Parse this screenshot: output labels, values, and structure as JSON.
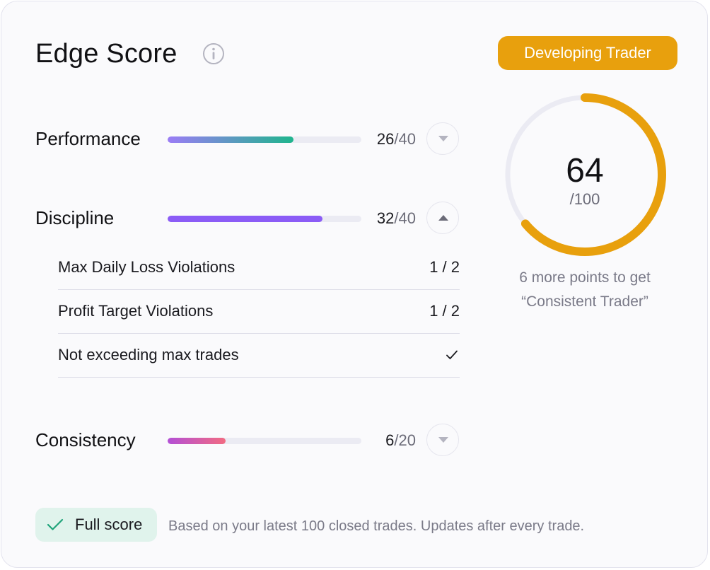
{
  "card": {
    "title": "Edge Score",
    "badge": "Developing Trader"
  },
  "categories": [
    {
      "label": "Performance",
      "score": "26",
      "max": "/40",
      "progress": 0.65,
      "gradient": [
        "#9b7cf6",
        "#1fb58d"
      ],
      "expanded": false
    },
    {
      "label": "Discipline",
      "score": "32",
      "max": "/40",
      "progress": 0.8,
      "gradient": [
        "#8b5cf6",
        "#8b5cf6"
      ],
      "expanded": true,
      "details": [
        {
          "label": "Max Daily Loss Violations",
          "value": "1 / 2"
        },
        {
          "label": "Profit Target Violations",
          "value": "1 / 2"
        },
        {
          "label": "Not exceeding max trades",
          "value": "",
          "icon": "check-icon"
        }
      ]
    },
    {
      "label": "Consistency",
      "score": "6",
      "max": "/20",
      "progress": 0.3,
      "gradient": [
        "#b34fd6",
        "#f26b82"
      ],
      "expanded": false
    }
  ],
  "total": {
    "value": "64",
    "max": "/100",
    "progress": 0.64,
    "color": "#e8a00d",
    "track_color": "#ebebf3",
    "next_line1": "6 more points to get",
    "next_line2": "“Consistent Trader”"
  },
  "footer": {
    "pill_label": "Full score",
    "note": "Based on your latest 100 closed trades. Updates after every trade."
  },
  "colors": {
    "accent": "#e8a00d",
    "success": "#1fa47a",
    "pill_bg": "#e0f3ec"
  }
}
